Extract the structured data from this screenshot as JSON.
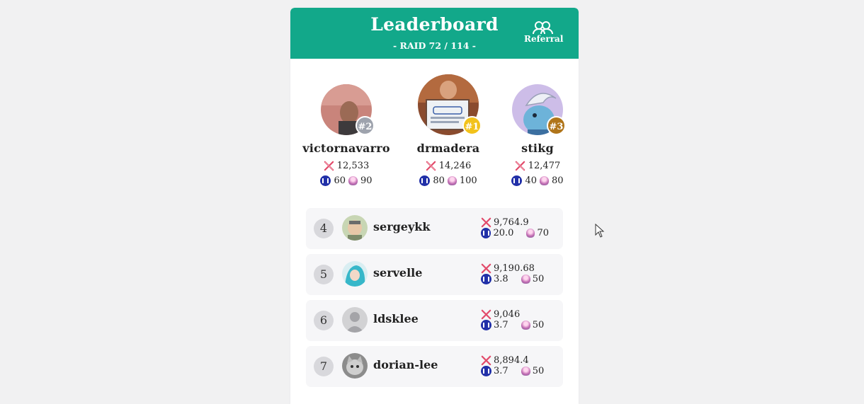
{
  "header": {
    "title": "Leaderboard",
    "subtitle": "- RAID 72 / 114 -",
    "referral_label": "Referral",
    "color": "#12a88a"
  },
  "podium": [
    {
      "rank_label": "#2",
      "name": "victornavarro",
      "damage": "12,533",
      "steem": "60",
      "gems": "90",
      "badge_color": "#9ea3ad"
    },
    {
      "rank_label": "#1",
      "name": "drmadera",
      "damage": "14,246",
      "steem": "80",
      "gems": "100",
      "badge_color": "#f2c21b"
    },
    {
      "rank_label": "#3",
      "name": "stikg",
      "damage": "12,477",
      "steem": "40",
      "gems": "80",
      "badge_color": "#b0751a"
    }
  ],
  "rows": [
    {
      "rank": "4",
      "name": "sergeykk",
      "damage": "9,764.9",
      "steem": "20.0",
      "gems": "70"
    },
    {
      "rank": "5",
      "name": "servelle",
      "damage": "9,190.68",
      "steem": "3.8",
      "gems": "50"
    },
    {
      "rank": "6",
      "name": "ldsklee",
      "damage": "9,046",
      "steem": "3.7",
      "gems": "50"
    },
    {
      "rank": "7",
      "name": "dorian-lee",
      "damage": "8,894.4",
      "steem": "3.7",
      "gems": "50"
    }
  ],
  "icons": {
    "damage": "crossed-swords-icon",
    "steem": "steem-coin-icon",
    "gem": "gem-icon",
    "referral": "users-icon"
  }
}
